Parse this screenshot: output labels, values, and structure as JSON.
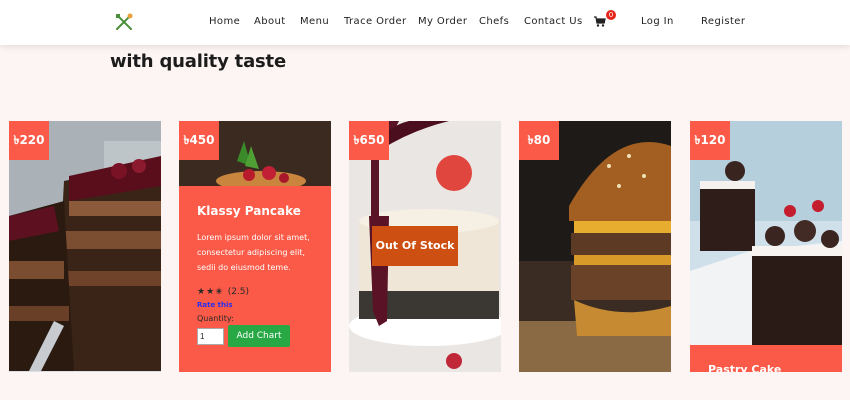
{
  "nav": {
    "items": [
      "Home",
      "About",
      "Menu",
      "Trace Order",
      "My Order",
      "Chefs",
      "Contact Us"
    ],
    "cart_count": "0",
    "login": "Log In",
    "register": "Register"
  },
  "section": {
    "heading": "with quality taste"
  },
  "products": [
    {
      "price": "৳220"
    },
    {
      "price": "৳450",
      "name": "Klassy Pancake",
      "description": "Lorem ipsum dolor sit amet, consectetur adipiscing elit, sedii do eiusmod teme.",
      "stars": "★★✬",
      "rating": "(2.5)",
      "rate_link": "Rate this",
      "quantity_label": "Quantity:",
      "quantity_value": "1",
      "add_button": "Add Chart"
    },
    {
      "price": "৳650",
      "status": "Out Of Stock"
    },
    {
      "price": "৳80"
    },
    {
      "price": "৳120",
      "name": "Pastry Cake"
    }
  ],
  "colors": {
    "accent": "#fa5a47",
    "add_button": "#27a845",
    "out_of_stock": "#cd4f12",
    "rate_link": "#2b2ff0",
    "cart_badge": "#e5241b"
  }
}
